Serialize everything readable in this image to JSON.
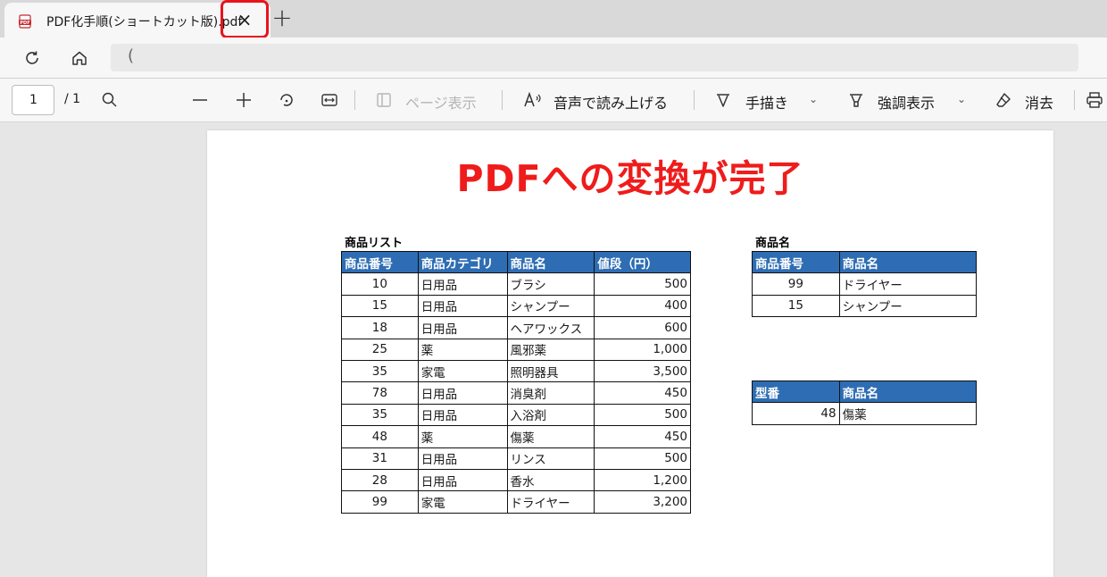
{
  "tab": {
    "title": "PDF化手順(ショートカット版).pdf",
    "close_label": "×",
    "new_tab_label": "+"
  },
  "address": {
    "prefix": "("
  },
  "toolbar": {
    "page_current": "1",
    "page_total": "/ 1",
    "page_view_label": "ページ表示",
    "read_aloud_label": "音声で読み上げる",
    "draw_label": "手描き",
    "highlight_label": "強調表示",
    "erase_label": "消去",
    "chevron": "⌄"
  },
  "document": {
    "title": "PDFへの変換が完了",
    "product_list": {
      "caption": "商品リスト",
      "headers": [
        "商品番号",
        "商品カテゴリ",
        "商品名",
        "値段（円）"
      ],
      "rows": [
        [
          "10",
          "日用品",
          "ブラシ",
          "500"
        ],
        [
          "15",
          "日用品",
          "シャンプー",
          "400"
        ],
        [
          "18",
          "日用品",
          "ヘアワックス",
          "600"
        ],
        [
          "25",
          "薬",
          "風邪薬",
          "1,000"
        ],
        [
          "35",
          "家電",
          "照明器具",
          "3,500"
        ],
        [
          "78",
          "日用品",
          "消臭剤",
          "450"
        ],
        [
          "35",
          "日用品",
          "入浴剤",
          "500"
        ],
        [
          "48",
          "薬",
          "傷薬",
          "450"
        ],
        [
          "31",
          "日用品",
          "リンス",
          "500"
        ],
        [
          "28",
          "日用品",
          "香水",
          "1,200"
        ],
        [
          "99",
          "家電",
          "ドライヤー",
          "3,200"
        ]
      ]
    },
    "name_lookup": {
      "caption": "商品名",
      "headers": [
        "商品番号",
        "商品名"
      ],
      "rows": [
        [
          "99",
          "ドライヤー"
        ],
        [
          "15",
          "シャンプー"
        ]
      ]
    },
    "model_lookup": {
      "headers": [
        "型番",
        "商品名"
      ],
      "rows": [
        [
          "48",
          "傷薬"
        ]
      ]
    }
  },
  "colors": {
    "accent_red": "#ef1c1c",
    "header_blue": "#2e6db3"
  }
}
